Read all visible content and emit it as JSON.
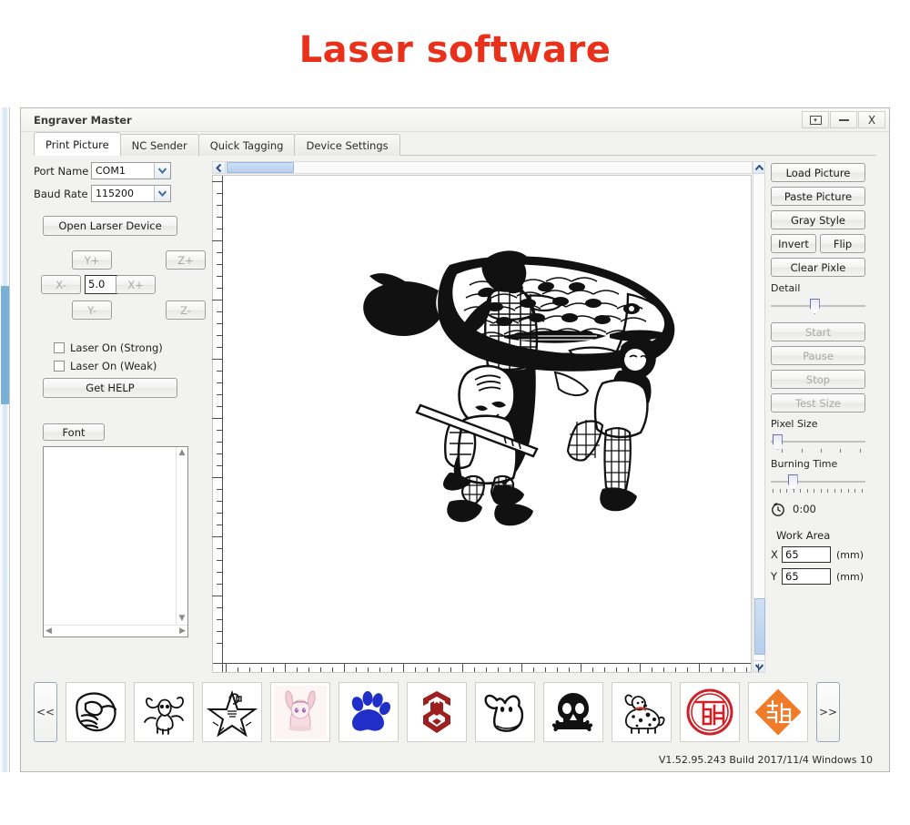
{
  "banner": {
    "title": "Laser software"
  },
  "window": {
    "title": "Engraver Master",
    "buttons": {
      "restore": "restore-box",
      "minimize": "minimize",
      "close": "X"
    }
  },
  "tabs": [
    {
      "label": "Print Picture",
      "active": true
    },
    {
      "label": "NC Sender",
      "active": false
    },
    {
      "label": "Quick Tagging",
      "active": false
    },
    {
      "label": "Device Settings",
      "active": false
    }
  ],
  "left_panel": {
    "port_name_label": "Port Name",
    "port_name_value": "COM1",
    "baud_rate_label": "Baud Rate",
    "baud_rate_value": "115200",
    "open_device_label": "Open Larser Device",
    "jog": {
      "y_plus": "Y+",
      "y_minus": "Y-",
      "x_plus": "X+",
      "x_minus": "X-",
      "z_plus": "Z+",
      "z_minus": "Z-",
      "step_value": "5.0"
    },
    "laser_strong_label": "Laser On (Strong)",
    "laser_weak_label": "Laser On (Weak)",
    "laser_strong_checked": false,
    "laser_weak_checked": false,
    "help_label": "Get HELP",
    "font_label": "Font",
    "textbox_value": ""
  },
  "right_panel": {
    "load_picture": "Load Picture",
    "paste_picture": "Paste Picture",
    "gray_style": "Gray Style",
    "invert": "Invert",
    "flip": "Flip",
    "clear_pixle": "Clear Pixle",
    "detail_label": "Detail",
    "detail_percent": 46,
    "start": "Start",
    "pause": "Pause",
    "stop": "Stop",
    "test_size": "Test Size",
    "pixel_size_label": "Pixel Size",
    "pixel_size_percent": 2,
    "pixel_size_ticks": 5,
    "burning_time_label": "Burning Time",
    "burning_time_percent": 20,
    "burning_time_ticks": 14,
    "clock_time": "0:00",
    "work_area_label": "Work Area",
    "work_area_x_axis": "X",
    "work_area_x_value": "65",
    "work_area_y_axis": "Y",
    "work_area_y_value": "65",
    "unit": "(mm)"
  },
  "canvas": {
    "artwork_alt": "Line art of three people carrying a giant fish"
  },
  "gallery": {
    "prev_label": "<<",
    "next_label": ">>",
    "items": [
      {
        "name": "pointing-hand",
        "icon": "pointing-hand"
      },
      {
        "name": "bull",
        "icon": "bull"
      },
      {
        "name": "star-emblem",
        "icon": "star-emblem"
      },
      {
        "name": "anime-bunny-girl",
        "icon": "anime-bunny-girl"
      },
      {
        "name": "paw-print",
        "icon": "paw-print"
      },
      {
        "name": "transformers-logo",
        "icon": "transformers-logo"
      },
      {
        "name": "ghost",
        "icon": "ghost"
      },
      {
        "name": "skull-crossbones",
        "icon": "skull-crossbones"
      },
      {
        "name": "dalmatian-dog",
        "icon": "dalmatian-dog"
      },
      {
        "name": "fu-seal-round",
        "icon": "fu-seal-round"
      },
      {
        "name": "fu-diamond",
        "icon": "fu-diamond"
      }
    ]
  },
  "status": {
    "version": "V1.52.95.243 Build 2017/11/4 Windows 10"
  },
  "colors": {
    "banner_red": "#e8301a",
    "paw_blue": "#1f2fc8",
    "transformer_red": "#9e1f20",
    "fu_red": "#cc2229",
    "fu_orange": "#f07c2a",
    "scroll_blue": "#b6cfec"
  }
}
